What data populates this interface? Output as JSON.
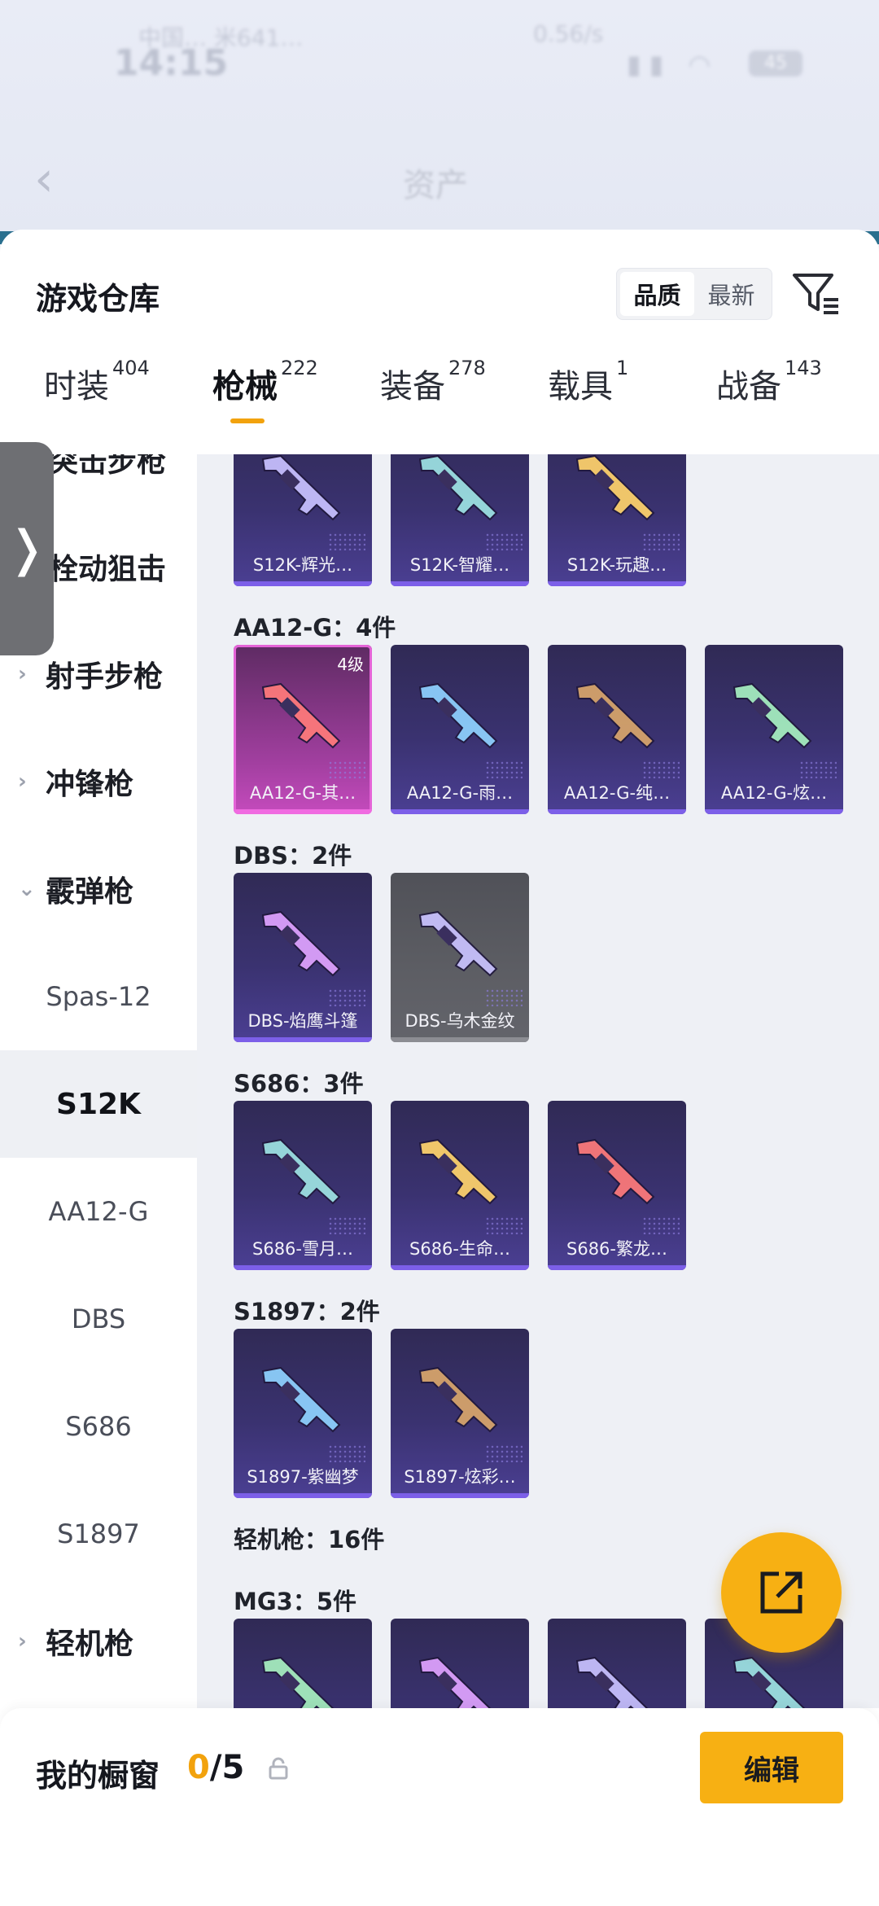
{
  "status": {
    "time": "14:15",
    "carrier": "中国… 米641…",
    "speed": "0.56/s",
    "battery": "45"
  },
  "header": {
    "title": "资产"
  },
  "sheet": {
    "title": "游戏仓库",
    "sort": {
      "options": [
        "品质",
        "最新"
      ],
      "selected": "品质"
    }
  },
  "tabs": [
    {
      "label": "时装",
      "count": "404"
    },
    {
      "label": "枪械",
      "count": "222",
      "active": true
    },
    {
      "label": "装备",
      "count": "278"
    },
    {
      "label": "载具",
      "count": "1"
    },
    {
      "label": "战备",
      "count": "143"
    }
  ],
  "sidebar": {
    "items": [
      {
        "label": "突击步枪",
        "type": "category"
      },
      {
        "label": "栓动狙击",
        "type": "category"
      },
      {
        "label": "射手步枪",
        "type": "category",
        "chevron": "›"
      },
      {
        "label": "冲锋枪",
        "type": "category",
        "chevron": "›"
      },
      {
        "label": "霰弹枪",
        "type": "category",
        "chevron": "⌄"
      },
      {
        "label": "Spas-12",
        "type": "sub"
      },
      {
        "label": "S12K",
        "type": "sub",
        "selected": true
      },
      {
        "label": "AA12-G",
        "type": "sub"
      },
      {
        "label": "DBS",
        "type": "sub"
      },
      {
        "label": "S686",
        "type": "sub"
      },
      {
        "label": "S1897",
        "type": "sub"
      },
      {
        "label": "轻机枪",
        "type": "category",
        "chevron": "›"
      }
    ]
  },
  "groups": [
    {
      "title": "",
      "items": [
        {
          "name": "S12K-辉光…"
        },
        {
          "name": "S12K-智耀…"
        },
        {
          "name": "S12K-玩趣…"
        }
      ]
    },
    {
      "title": "AA12-G：4件",
      "items": [
        {
          "name": "AA12-G-其…",
          "level": "4级",
          "style": "pink"
        },
        {
          "name": "AA12-G-雨…"
        },
        {
          "name": "AA12-G-纯…"
        },
        {
          "name": "AA12-G-炫…"
        }
      ]
    },
    {
      "title": "DBS：2件",
      "items": [
        {
          "name": "DBS-焰鹰斗篷"
        },
        {
          "name": "DBS-乌木金纹",
          "style": "gray"
        }
      ]
    },
    {
      "title": "S686：3件",
      "items": [
        {
          "name": "S686-雪月…"
        },
        {
          "name": "S686-生命…"
        },
        {
          "name": "S686-繁龙…"
        }
      ]
    },
    {
      "title": "S1897：2件",
      "items": [
        {
          "name": "S1897-紫幽梦"
        },
        {
          "name": "S1897-炫彩…"
        }
      ]
    },
    {
      "title": "轻机枪：16件",
      "items": []
    },
    {
      "title": "MG3：5件",
      "items": [
        {
          "name": ""
        },
        {
          "name": ""
        },
        {
          "name": ""
        },
        {
          "name": ""
        }
      ]
    }
  ],
  "bottom": {
    "showcase_label": "我的橱窗",
    "showcase_current": "0",
    "showcase_total": "/5",
    "edit_label": "编辑"
  },
  "colors": {
    "accent": "#f7b013",
    "underline": "#f2a20d",
    "card_purple": "#3a3270",
    "card_pink": "#c54bbd"
  },
  "icons": [
    "back-arrow-icon",
    "filter-icon",
    "chevron-right-icon",
    "chevron-down-icon",
    "share-icon",
    "lock-icon",
    "expand-handle-icon"
  ]
}
